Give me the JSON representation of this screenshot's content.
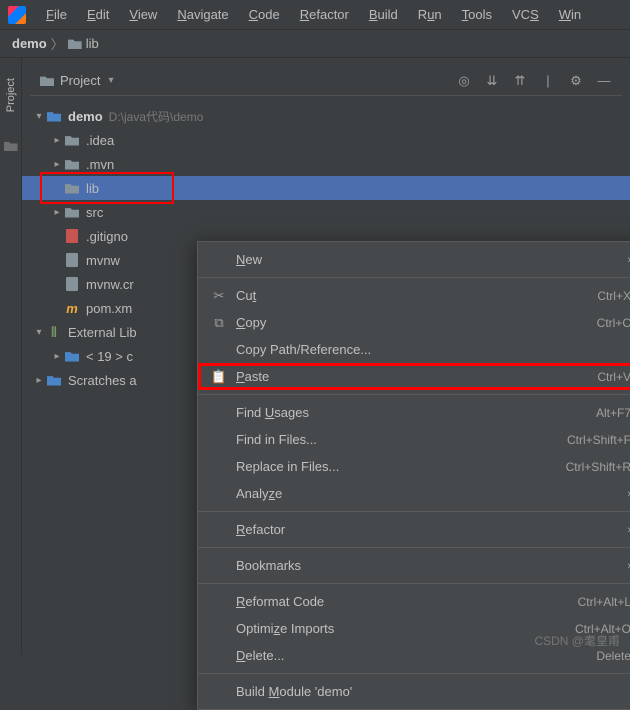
{
  "menubar": {
    "items": [
      "File",
      "Edit",
      "View",
      "Navigate",
      "Code",
      "Refactor",
      "Build",
      "Run",
      "Tools",
      "VCS",
      "Win"
    ]
  },
  "breadcrumb": {
    "root": "demo",
    "child": "lib"
  },
  "panel": {
    "title": "Project"
  },
  "side_tab": "Project",
  "tree": {
    "root_name": "demo",
    "root_path": "D:\\java代码\\demo",
    "items": [
      {
        "name": ".idea"
      },
      {
        "name": ".mvn"
      },
      {
        "name": "lib"
      },
      {
        "name": "src"
      },
      {
        "name": ".gitigno"
      },
      {
        "name": "mvnw"
      },
      {
        "name": "mvnw.cr"
      },
      {
        "name": "pom.xm"
      }
    ],
    "external": "External Lib",
    "jdk": "< 19 > c",
    "scratches": "Scratches a"
  },
  "context": {
    "new": "New",
    "cut": {
      "label": "Cut",
      "shortcut": "Ctrl+X"
    },
    "copy": {
      "label": "Copy",
      "shortcut": "Ctrl+C"
    },
    "copypath": "Copy Path/Reference...",
    "paste": {
      "label": "Paste",
      "shortcut": "Ctrl+V"
    },
    "findusages": {
      "label": "Find Usages",
      "shortcut": "Alt+F7"
    },
    "findinfiles": {
      "label": "Find in Files...",
      "shortcut": "Ctrl+Shift+F"
    },
    "replaceinfiles": {
      "label": "Replace in Files...",
      "shortcut": "Ctrl+Shift+R"
    },
    "analyze": "Analyze",
    "refactor": "Refactor",
    "bookmarks": "Bookmarks",
    "reformat": {
      "label": "Reformat Code",
      "shortcut": "Ctrl+Alt+L"
    },
    "optimize": {
      "label": "Optimize Imports",
      "shortcut": "Ctrl+Alt+O"
    },
    "delete": {
      "label": "Delete...",
      "shortcut": "Delete"
    },
    "buildmodule": "Build Module 'demo'"
  },
  "watermark": "CSDN @耄皇甫"
}
